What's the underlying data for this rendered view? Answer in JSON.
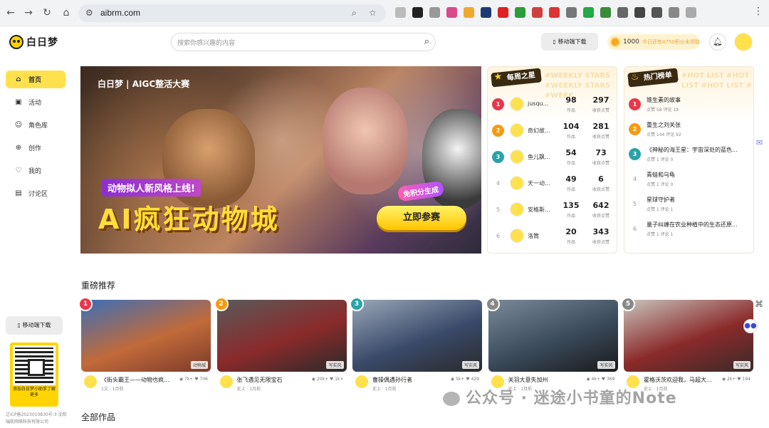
{
  "browser": {
    "url": "aibrm.com"
  },
  "header": {
    "logo": "白日梦",
    "search_placeholder": "搜索你感兴趣的内容",
    "download_label": "移动端下载",
    "points": "1000",
    "points_tip": "今日还有4750积分未领取"
  },
  "sidebar": {
    "items": [
      {
        "label": "首页",
        "icon": "home-icon"
      },
      {
        "label": "活动",
        "icon": "activity-icon"
      },
      {
        "label": "角色库",
        "icon": "character-icon"
      },
      {
        "label": "创作",
        "icon": "create-icon"
      },
      {
        "label": "我的",
        "icon": "user-icon"
      },
      {
        "label": "讨论区",
        "icon": "discuss-icon"
      }
    ],
    "download_label": "移动端下载",
    "qr_caption": "添加白日梦小助手了解更多",
    "icp": "辽ICP备2023010830号-3 沈阳瑞航网络科技有限公司"
  },
  "banner": {
    "logo": "白日梦 | AIGC整活大赛",
    "subtitle": "动物拟人新风格上线!",
    "title": "AI疯狂动物城",
    "free_badge": "免积分生成",
    "cta": "立即参赛"
  },
  "star_board": {
    "title": "每周之星",
    "watermark": "#WEEKLY STARS #WEEKLY STARS #WEEK",
    "work_label": "作品",
    "likes_label": "收获点赞",
    "rows": [
      {
        "rank": "1",
        "name": "jusqu...",
        "works": "98",
        "likes": "297"
      },
      {
        "rank": "2",
        "name": "奇幻故...",
        "works": "104",
        "likes": "281"
      },
      {
        "rank": "3",
        "name": "鱼儿飘...",
        "works": "54",
        "likes": "73"
      },
      {
        "rank": "4",
        "name": "天一动...",
        "works": "49",
        "likes": "6"
      },
      {
        "rank": "5",
        "name": "安格斯...",
        "works": "135",
        "likes": "642"
      },
      {
        "rank": "6",
        "name": "洛筒",
        "works": "20",
        "likes": "343"
      }
    ]
  },
  "hot_board": {
    "title": "热门榜单",
    "watermark": "#HOT LIST #HOT LIST #HOT LIST #",
    "rows": [
      {
        "rank": "1",
        "title": "锥生素的故事",
        "meta": "点赞 58   评论 19"
      },
      {
        "rank": "2",
        "title": "重生之刘关张",
        "meta": "点赞 144   评论 92"
      },
      {
        "rank": "3",
        "title": "《神秘的海王星：宇宙深处的蓝色...",
        "meta": "点赞 1   评论 0"
      },
      {
        "rank": "4",
        "title": "青蛙和乌龟",
        "meta": "点赞 1   评论 0"
      },
      {
        "rank": "5",
        "title": "星球守护者",
        "meta": "点赞 1   评论 1"
      },
      {
        "rank": "6",
        "title": "量子纠缠在农业种植中的生态还原...",
        "meta": "点赞 1   评论 1"
      }
    ]
  },
  "featured": {
    "title": "重磅推荐",
    "cards": [
      {
        "rank": "1",
        "tag": "动物城",
        "title": "《街头霸王——动物也疯...",
        "meta": "1文 · 1月前",
        "views": "7k+",
        "likes": "706"
      },
      {
        "rank": "2",
        "tag": "写实风",
        "title": "张飞遇见无限宝石",
        "meta": "史上 · 1月前",
        "views": "20k+",
        "likes": "1k+"
      },
      {
        "rank": "3",
        "tag": "写实风",
        "title": "曹操偶遇孙行者",
        "meta": "史上 · 1月前",
        "views": "5k+",
        "likes": "429"
      },
      {
        "rank": "4",
        "tag": "写实风",
        "title": "关羽大意失加州",
        "meta": "史上 · 1月前",
        "views": "4k+",
        "likes": "369"
      },
      {
        "rank": "5",
        "tag": "写实风",
        "title": "霍格沃茨欢迎我，马超大...",
        "meta": "史上 · 1月前",
        "views": "2k+",
        "likes": "194"
      }
    ]
  },
  "all_works": {
    "title": "全部作品"
  },
  "watermark": "公众号 · 迷途小书童的Note"
}
